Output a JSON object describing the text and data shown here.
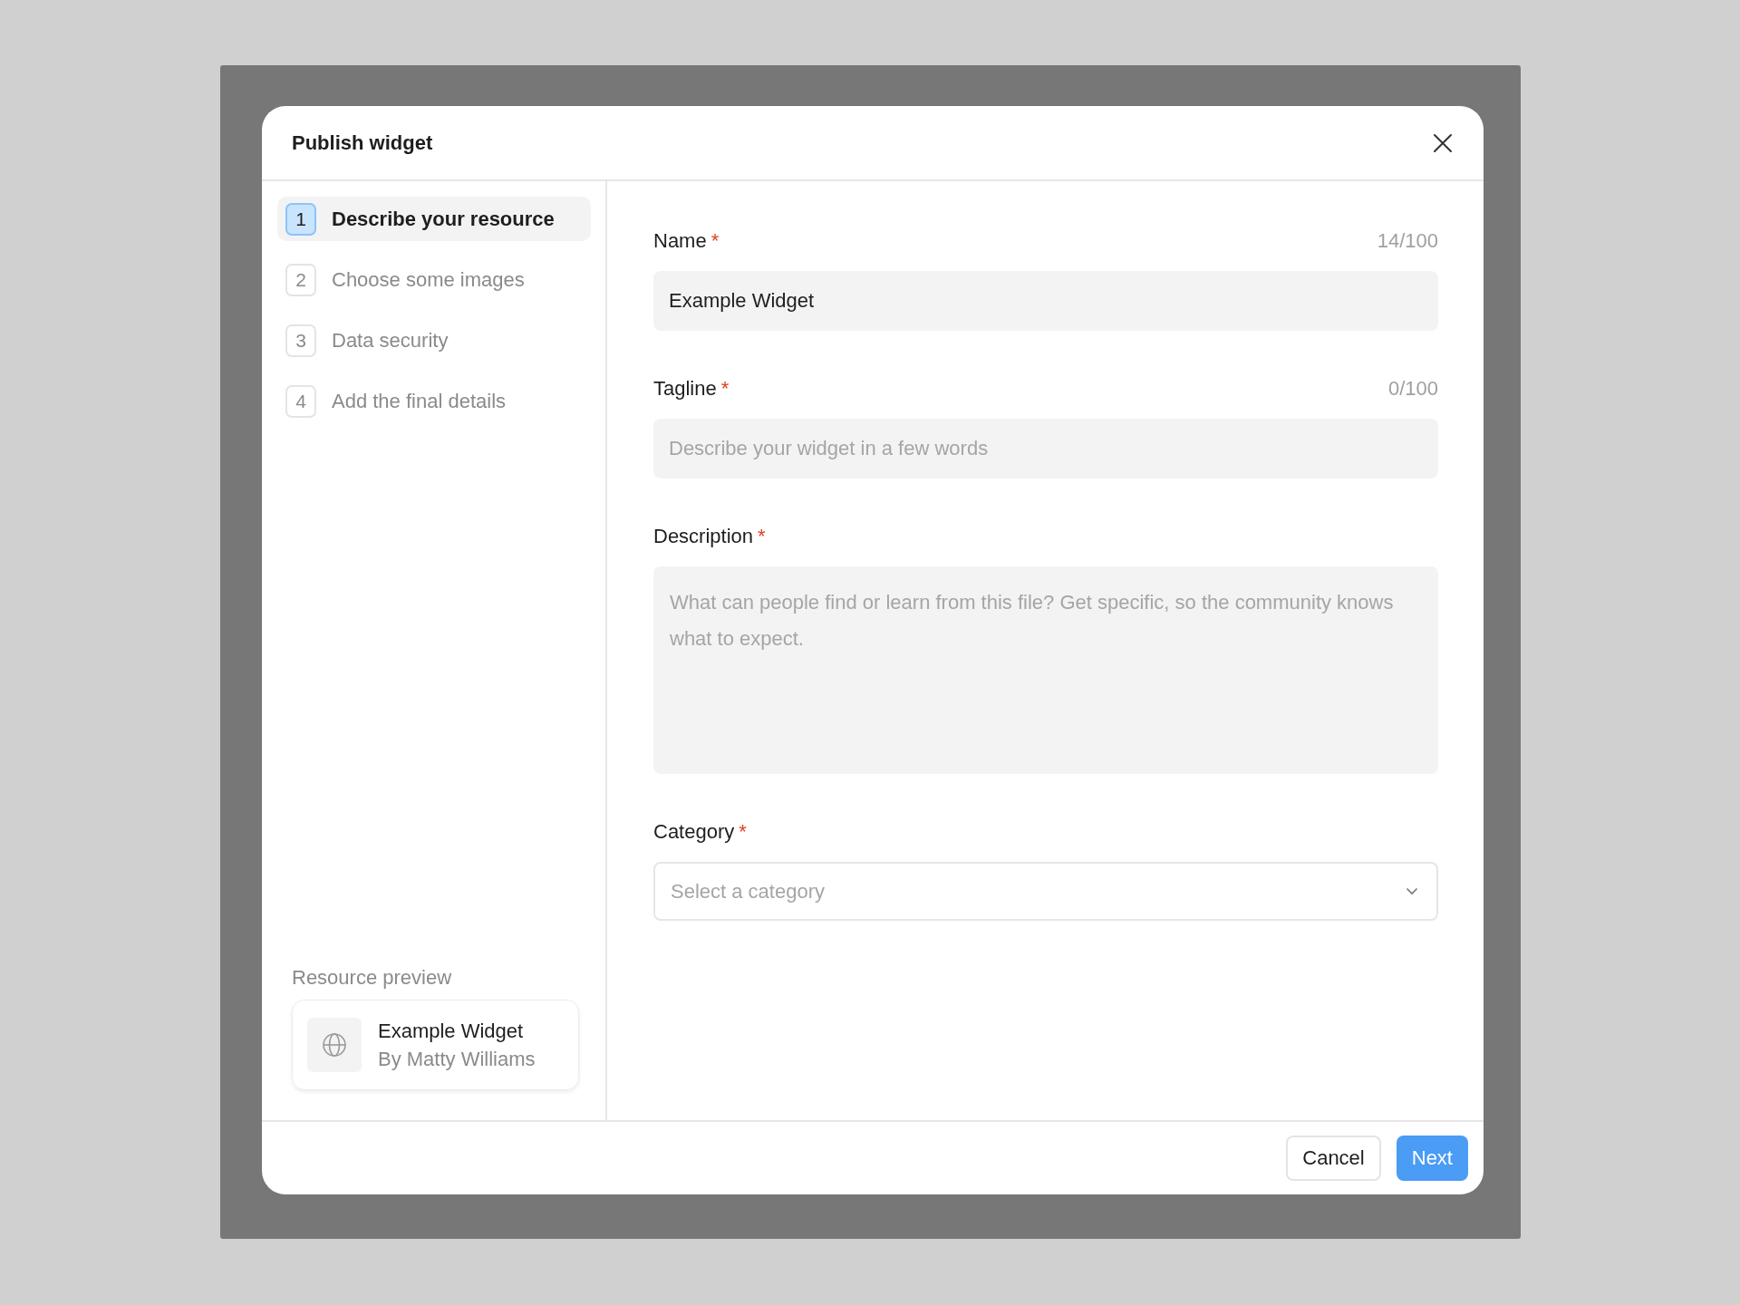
{
  "dialog": {
    "title": "Publish widget"
  },
  "steps": [
    {
      "number": "1",
      "label": "Describe your resource",
      "selected": true
    },
    {
      "number": "2",
      "label": "Choose some images",
      "selected": false
    },
    {
      "number": "3",
      "label": "Data security",
      "selected": false
    },
    {
      "number": "4",
      "label": "Add the final details",
      "selected": false
    }
  ],
  "preview": {
    "heading": "Resource preview",
    "name": "Example Widget",
    "author": "By Matty Williams"
  },
  "fields": [
    {
      "kind": "text",
      "label": "Name",
      "required_mark": "*",
      "counter": "14/100",
      "value": "Example Widget"
    },
    {
      "kind": "text",
      "label": "Tagline",
      "required_mark": "*",
      "counter": "0/100",
      "placeholder": "Describe your widget in a few words"
    },
    {
      "kind": "textarea",
      "label": "Description",
      "required_mark": "*",
      "placeholder": "What can people find or learn from this file? Get specific, so the community knows what to expect."
    },
    {
      "kind": "select",
      "label": "Category",
      "required_mark": "*",
      "placeholder": "Select a category"
    }
  ],
  "buttons": {
    "cancel": "Cancel",
    "next": "Next"
  }
}
